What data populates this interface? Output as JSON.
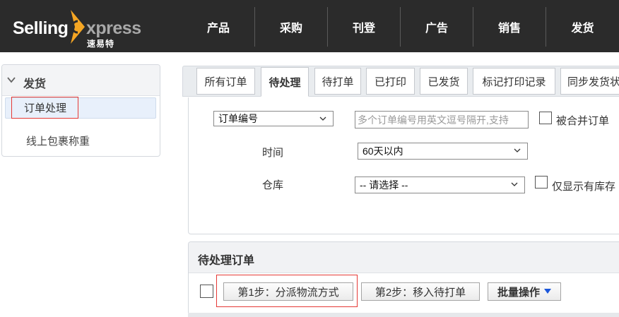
{
  "logo": {
    "word_left": "Selling",
    "word_right": "xpress",
    "chinese": "速易特",
    "colors": {
      "arrow": "#f5a623",
      "selling": "#ffffff",
      "xpress": "#a8a8a8"
    }
  },
  "nav": {
    "items": [
      "产品",
      "采购",
      "刊登",
      "广告",
      "销售",
      "发货"
    ]
  },
  "sidebar": {
    "title": "发货",
    "chevron_icon": "chevron-down-icon",
    "items": [
      {
        "label": "订单处理",
        "active": true
      },
      {
        "label": "线上包裹称重",
        "active": false
      }
    ]
  },
  "tabs": [
    {
      "label": "所有订单",
      "active": false
    },
    {
      "label": "待处理",
      "active": true
    },
    {
      "label": "待打单",
      "active": false
    },
    {
      "label": "已打印",
      "active": false
    },
    {
      "label": "已发货",
      "active": false
    },
    {
      "label": "标记打印记录",
      "active": false
    },
    {
      "label": "同步发货状",
      "active": false
    }
  ],
  "filters": {
    "search_type": {
      "value": "订单编号"
    },
    "search_input": {
      "placeholder": "多个订单编号用英文逗号隔开,支持"
    },
    "merged_orders_checkbox": {
      "label": "被合并订单",
      "checked": false
    },
    "time": {
      "label": "时间",
      "value": "60天以内"
    },
    "warehouse": {
      "label": "仓库",
      "value": "-- 请选择 --"
    },
    "in_stock_checkbox": {
      "label": "仅显示有库存",
      "checked": false
    }
  },
  "pending": {
    "title": "待处理订单",
    "select_all_checked": false,
    "step1_label": "第1步：分派物流方式",
    "step2_label": "第2步：移入待打单",
    "bulk_label": "批量操作",
    "bulk_icon": "caret-down-icon",
    "accent": "#1a56db"
  },
  "highlight_color": "#e53935"
}
